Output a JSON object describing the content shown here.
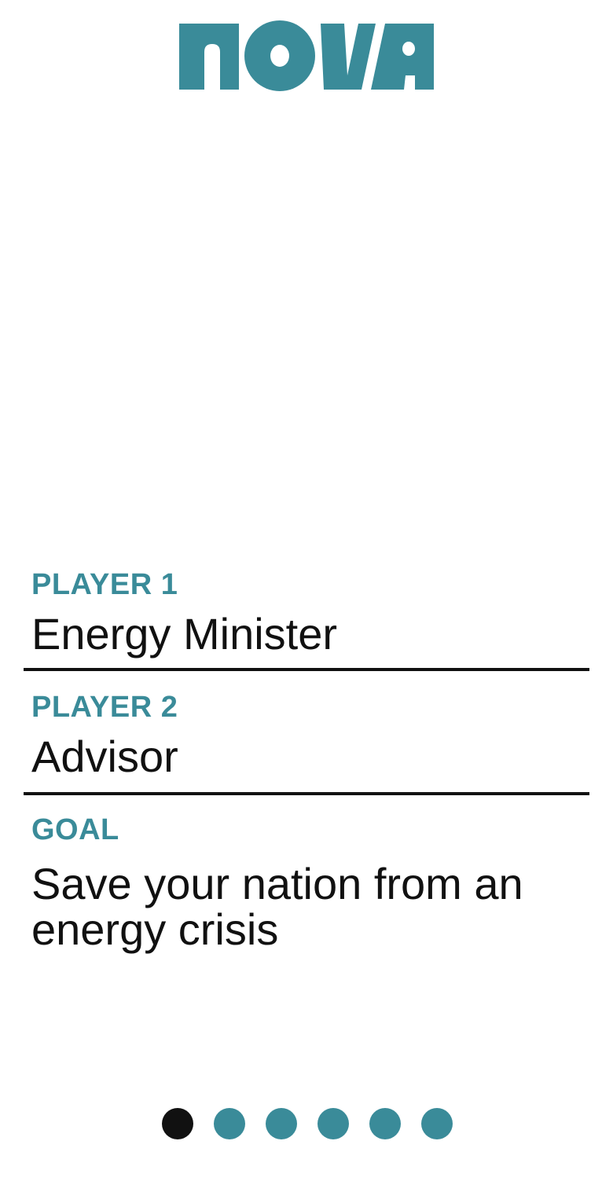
{
  "app": {
    "logo_text": "NOVA",
    "accent_color": "#3a8b99",
    "text_color": "#111111"
  },
  "roles": {
    "player1": {
      "label": "PLAYER 1",
      "value": "Energy Minister"
    },
    "player2": {
      "label": "PLAYER 2",
      "value": "Advisor"
    },
    "goal": {
      "label": "GOAL",
      "value": "Save your nation from an energy crisis"
    }
  },
  "pager": {
    "total_pages": 6,
    "current_page": 1
  }
}
